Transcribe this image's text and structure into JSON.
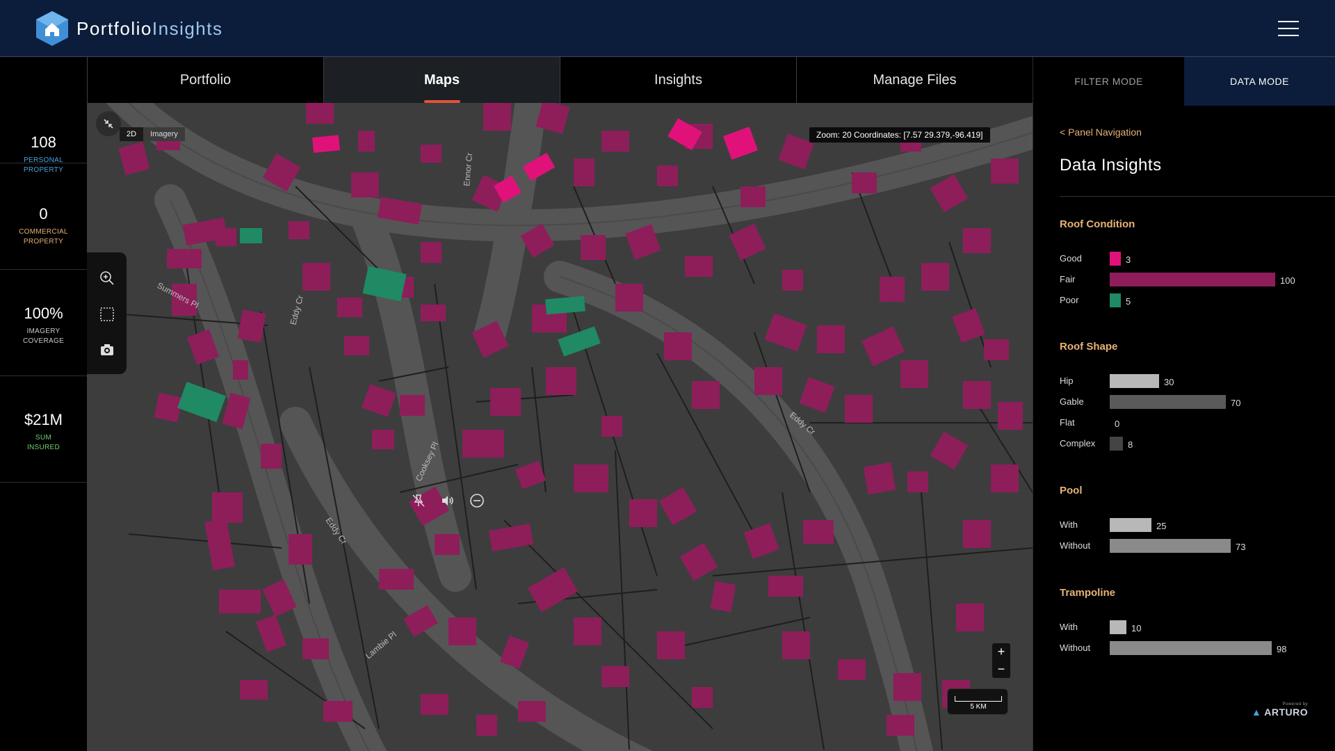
{
  "header": {
    "brand_part1": "Portfolio",
    "brand_part2": "Insights",
    "menu_icon": "hamburger-icon"
  },
  "stats": [
    {
      "value": "108",
      "label_line1": "PERSONAL",
      "label_line2": "PROPERTY",
      "color": "#4aa3df"
    },
    {
      "value": "0",
      "label_line1": "COMMERCIAL",
      "label_line2": "PROPERTY",
      "color": "#e8b277"
    },
    {
      "value": "100%",
      "label_line1": "IMAGERY",
      "label_line2": "COVERAGE",
      "color": "#c9c9c9"
    },
    {
      "value": "$21M",
      "label_line1": "SUM",
      "label_line2": "INSURED",
      "color": "#6fd26f"
    }
  ],
  "tabs": [
    {
      "label": "Portfolio",
      "active": false
    },
    {
      "label": "Maps",
      "active": true
    },
    {
      "label": "Insights",
      "active": false
    },
    {
      "label": "Manage Files",
      "active": false
    }
  ],
  "map": {
    "mode_2d": "2D",
    "mode_imagery": "Imagery",
    "zoom_readout": "Zoom: 20 Coordinates: [7.57 29.379,-96.419]",
    "scale_label": "5 KM",
    "zoom_in": "+",
    "zoom_out": "−",
    "street_labels": [
      "Summers Pl",
      "Eddy Cr",
      "Ennor Cr",
      "Cooksey Pl",
      "Eddy Cr",
      "Eddy Cr",
      "Lambie Pl"
    ],
    "tools": [
      "zoom-in-icon",
      "select-box-icon",
      "camera-icon"
    ],
    "mid_controls": [
      "pin-off-icon",
      "volume-icon",
      "minus-circle-icon"
    ],
    "colors": {
      "good": "#e0127a",
      "fair": "#8e1e5a",
      "poor": "#1f8a63"
    }
  },
  "right_panel": {
    "filter_mode": "FILTER MODE",
    "data_mode": "DATA MODE",
    "panel_nav": "<  Panel Navigation",
    "title": "Data Insights",
    "sections": [
      {
        "title": "Roof Condition",
        "max": 100,
        "rows": [
          {
            "label": "Good",
            "value": 3,
            "color": "#e0127a"
          },
          {
            "label": "Fair",
            "value": 100,
            "color": "#8e1e5a"
          },
          {
            "label": "Poor",
            "value": 5,
            "color": "#1f8a63"
          }
        ]
      },
      {
        "title": "Roof Shape",
        "max": 100,
        "rows": [
          {
            "label": "Hip",
            "value": 30,
            "color": "#b8b8b8"
          },
          {
            "label": "Gable",
            "value": 70,
            "color": "#5a5a5a"
          },
          {
            "label": "Flat",
            "value": 0,
            "color": "#5a5a5a"
          },
          {
            "label": "Complex",
            "value": 8,
            "color": "#444444"
          }
        ]
      },
      {
        "title": "Pool",
        "max": 100,
        "rows": [
          {
            "label": "With",
            "value": 25,
            "color": "#b8b8b8"
          },
          {
            "label": "Without",
            "value": 73,
            "color": "#8a8a8a"
          }
        ]
      },
      {
        "title": "Trampoline",
        "max": 100,
        "rows": [
          {
            "label": "With",
            "value": 10,
            "color": "#b8b8b8"
          },
          {
            "label": "Without",
            "value": 98,
            "color": "#8a8a8a"
          }
        ]
      }
    ],
    "powered_by": "Powered by",
    "footer_brand": "ARTURO"
  }
}
